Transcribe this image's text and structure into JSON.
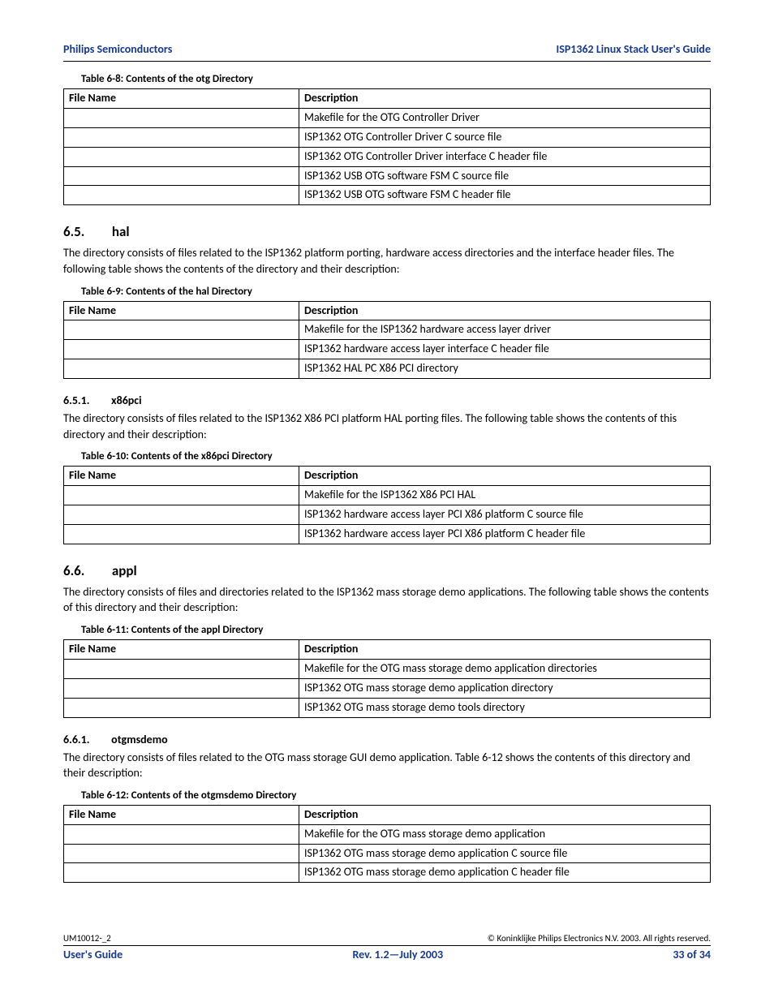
{
  "header": {
    "left": "Philips Semiconductors",
    "right": "ISP1362 Linux Stack User's Guide"
  },
  "table68": {
    "caption": "Table 6-8: Contents of the otg Directory",
    "headers": {
      "c1": "File Name",
      "c2": "Description"
    },
    "rows": [
      {
        "file": "",
        "desc": "Makefile for the OTG Controller Driver"
      },
      {
        "file": "",
        "desc": "ISP1362 OTG Controller Driver C source file"
      },
      {
        "file": "",
        "desc": "ISP1362 OTG Controller Driver interface C header file"
      },
      {
        "file": "",
        "desc": "ISP1362 USB OTG software FSM C source file"
      },
      {
        "file": "",
        "desc": "ISP1362 USB OTG software FSM C header file"
      }
    ]
  },
  "sec65": {
    "heading_num": "6.5.",
    "heading_title": "hal",
    "para": "The        directory consists of files related to the ISP1362 platform porting, hardware access directories and the interface header files. The following table shows the contents of the        directory and their description:"
  },
  "table69": {
    "caption": "Table 6-9: Contents of the hal Directory",
    "headers": {
      "c1": "File Name",
      "c2": "Description"
    },
    "rows": [
      {
        "file": "",
        "desc": "Makefile for the ISP1362 hardware access layer driver"
      },
      {
        "file": "",
        "desc": "ISP1362 hardware access layer interface C header file"
      },
      {
        "file": "",
        "desc": "ISP1362 HAL PC X86 PCI directory"
      }
    ]
  },
  "sec651": {
    "heading_num": "6.5.1.",
    "heading_title": "x86pci",
    "para": "The          directory consists of files related to the ISP1362 X86 PCI platform HAL porting files. The following table shows the contents of this directory and their description:"
  },
  "table610": {
    "caption": "Table 6-10: Contents of the x86pci Directory",
    "headers": {
      "c1": "File Name",
      "c2": "Description"
    },
    "rows": [
      {
        "file": "",
        "desc": "Makefile for the ISP1362 X86 PCI HAL"
      },
      {
        "file": "",
        "desc": "ISP1362 hardware access layer PCI X86 platform C source file"
      },
      {
        "file": "",
        "desc": "ISP1362 hardware access layer PCI X86 platform C header file"
      }
    ]
  },
  "sec66": {
    "heading_num": "6.6.",
    "heading_title": "appl",
    "para": "The        directory consists of files and directories related to the ISP1362 mass storage demo applications. The following table shows the contents of this directory and their description:"
  },
  "table611": {
    "caption": "Table 6-11: Contents of the appl Directory",
    "headers": {
      "c1": "File Name",
      "c2": "Description"
    },
    "rows": [
      {
        "file": "",
        "desc": "Makefile for the OTG mass storage demo application directories"
      },
      {
        "file": "",
        "desc": "ISP1362 OTG mass storage demo application directory"
      },
      {
        "file": "",
        "desc": "ISP1362 OTG mass storage demo tools directory"
      }
    ]
  },
  "sec661": {
    "heading_num": "6.6.1.",
    "heading_title": "otgmsdemo",
    "para": "The              directory consists of files related to the OTG mass storage GUI demo application. Table 6-12 shows the contents of this directory and their description:"
  },
  "table612": {
    "caption": "Table 6-12: Contents of the otgmsdemo Directory",
    "headers": {
      "c1": "File Name",
      "c2": "Description"
    },
    "rows": [
      {
        "file": "",
        "desc": "Makefile for the OTG mass storage demo application"
      },
      {
        "file": "",
        "desc": "ISP1362 OTG mass storage demo application C source file"
      },
      {
        "file": "",
        "desc": "ISP1362 OTG mass storage demo application C header file"
      }
    ]
  },
  "footer": {
    "topLeft": "UM10012-_2",
    "topRight": "© Koninklijke Philips Electronics N.V. 2003. All rights reserved.",
    "bottomLeft": "User's Guide",
    "bottomCenter": "Rev. 1.2—July 2003",
    "bottomRight": "33 of 34"
  }
}
